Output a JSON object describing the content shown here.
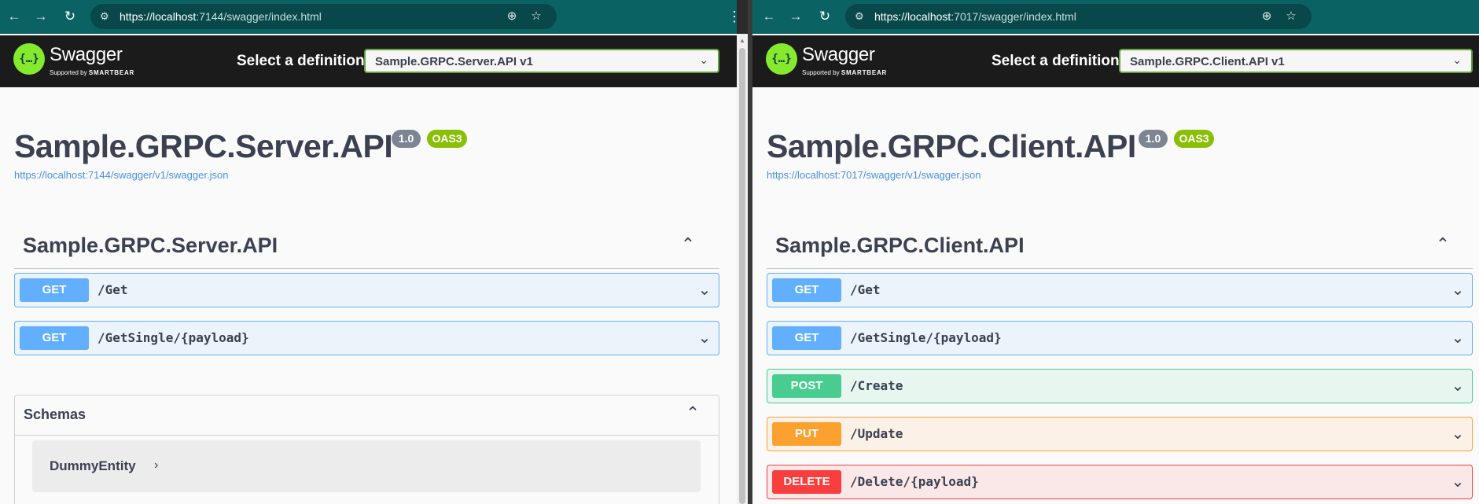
{
  "left": {
    "url": {
      "host": "https://localhost",
      "rest": ":7144/swagger/index.html"
    },
    "swagger": {
      "name": "Swagger",
      "supported_by": "Supported by",
      "smartbear": "SMARTBEAR",
      "logo_glyph": "{…}"
    },
    "definition": {
      "label": "Select a definition",
      "selected": "Sample.GRPC.Server.API v1"
    },
    "api": {
      "title": "Sample.GRPC.Server.API",
      "version": "1.0",
      "oas": "OAS3",
      "spec_url": "https://localhost:7144/swagger/v1/swagger.json"
    },
    "tag": {
      "name": "Sample.GRPC.Server.API"
    },
    "operations": [
      {
        "method": "GET",
        "path": "/Get"
      },
      {
        "method": "GET",
        "path": "/GetSingle/{payload}"
      }
    ],
    "schemas": {
      "title": "Schemas",
      "models": [
        {
          "name": "DummyEntity"
        }
      ]
    }
  },
  "right": {
    "url": {
      "host": "https://localhost",
      "rest": ":7017/swagger/index.html"
    },
    "swagger": {
      "name": "Swagger",
      "supported_by": "Supported by",
      "smartbear": "SMARTBEAR",
      "logo_glyph": "{…}"
    },
    "definition": {
      "label": "Select a definition",
      "selected": "Sample.GRPC.Client.API v1"
    },
    "api": {
      "title": "Sample.GRPC.Client.API",
      "version": "1.0",
      "oas": "OAS3",
      "spec_url": "https://localhost:7017/swagger/v1/swagger.json"
    },
    "tag": {
      "name": "Sample.GRPC.Client.API"
    },
    "operations": [
      {
        "method": "GET",
        "path": "/Get"
      },
      {
        "method": "GET",
        "path": "/GetSingle/{payload}"
      },
      {
        "method": "POST",
        "path": "/Create"
      },
      {
        "method": "PUT",
        "path": "/Update"
      },
      {
        "method": "DELETE",
        "path": "/Delete/{payload}"
      }
    ]
  },
  "colors": {
    "chrome_bar": "#0b6262",
    "swagger_header": "#1b1b1b",
    "get": "#61affe",
    "post": "#49cc90",
    "put": "#fca130",
    "delete": "#f93e3e",
    "version_badge": "#7d8492",
    "oas_badge": "#89bf04"
  },
  "icons": {
    "back": "back-arrow-icon",
    "forward": "forward-arrow-icon",
    "reload": "reload-icon",
    "site_info": "tune-icon",
    "zoom": "zoom-icon",
    "bookmark": "star-icon",
    "menu": "kebab-menu-icon"
  }
}
